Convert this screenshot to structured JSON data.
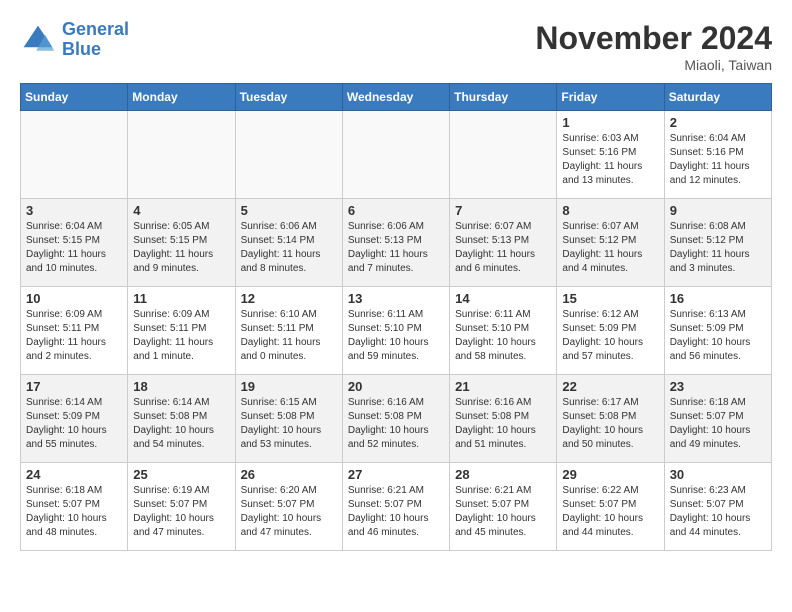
{
  "logo": {
    "line1": "General",
    "line2": "Blue"
  },
  "title": "November 2024",
  "location": "Miaoli, Taiwan",
  "days_header": [
    "Sunday",
    "Monday",
    "Tuesday",
    "Wednesday",
    "Thursday",
    "Friday",
    "Saturday"
  ],
  "weeks": [
    [
      {
        "day": "",
        "info": ""
      },
      {
        "day": "",
        "info": ""
      },
      {
        "day": "",
        "info": ""
      },
      {
        "day": "",
        "info": ""
      },
      {
        "day": "",
        "info": ""
      },
      {
        "day": "1",
        "info": "Sunrise: 6:03 AM\nSunset: 5:16 PM\nDaylight: 11 hours\nand 13 minutes."
      },
      {
        "day": "2",
        "info": "Sunrise: 6:04 AM\nSunset: 5:16 PM\nDaylight: 11 hours\nand 12 minutes."
      }
    ],
    [
      {
        "day": "3",
        "info": "Sunrise: 6:04 AM\nSunset: 5:15 PM\nDaylight: 11 hours\nand 10 minutes."
      },
      {
        "day": "4",
        "info": "Sunrise: 6:05 AM\nSunset: 5:15 PM\nDaylight: 11 hours\nand 9 minutes."
      },
      {
        "day": "5",
        "info": "Sunrise: 6:06 AM\nSunset: 5:14 PM\nDaylight: 11 hours\nand 8 minutes."
      },
      {
        "day": "6",
        "info": "Sunrise: 6:06 AM\nSunset: 5:13 PM\nDaylight: 11 hours\nand 7 minutes."
      },
      {
        "day": "7",
        "info": "Sunrise: 6:07 AM\nSunset: 5:13 PM\nDaylight: 11 hours\nand 6 minutes."
      },
      {
        "day": "8",
        "info": "Sunrise: 6:07 AM\nSunset: 5:12 PM\nDaylight: 11 hours\nand 4 minutes."
      },
      {
        "day": "9",
        "info": "Sunrise: 6:08 AM\nSunset: 5:12 PM\nDaylight: 11 hours\nand 3 minutes."
      }
    ],
    [
      {
        "day": "10",
        "info": "Sunrise: 6:09 AM\nSunset: 5:11 PM\nDaylight: 11 hours\nand 2 minutes."
      },
      {
        "day": "11",
        "info": "Sunrise: 6:09 AM\nSunset: 5:11 PM\nDaylight: 11 hours\nand 1 minute."
      },
      {
        "day": "12",
        "info": "Sunrise: 6:10 AM\nSunset: 5:11 PM\nDaylight: 11 hours\nand 0 minutes."
      },
      {
        "day": "13",
        "info": "Sunrise: 6:11 AM\nSunset: 5:10 PM\nDaylight: 10 hours\nand 59 minutes."
      },
      {
        "day": "14",
        "info": "Sunrise: 6:11 AM\nSunset: 5:10 PM\nDaylight: 10 hours\nand 58 minutes."
      },
      {
        "day": "15",
        "info": "Sunrise: 6:12 AM\nSunset: 5:09 PM\nDaylight: 10 hours\nand 57 minutes."
      },
      {
        "day": "16",
        "info": "Sunrise: 6:13 AM\nSunset: 5:09 PM\nDaylight: 10 hours\nand 56 minutes."
      }
    ],
    [
      {
        "day": "17",
        "info": "Sunrise: 6:14 AM\nSunset: 5:09 PM\nDaylight: 10 hours\nand 55 minutes."
      },
      {
        "day": "18",
        "info": "Sunrise: 6:14 AM\nSunset: 5:08 PM\nDaylight: 10 hours\nand 54 minutes."
      },
      {
        "day": "19",
        "info": "Sunrise: 6:15 AM\nSunset: 5:08 PM\nDaylight: 10 hours\nand 53 minutes."
      },
      {
        "day": "20",
        "info": "Sunrise: 6:16 AM\nSunset: 5:08 PM\nDaylight: 10 hours\nand 52 minutes."
      },
      {
        "day": "21",
        "info": "Sunrise: 6:16 AM\nSunset: 5:08 PM\nDaylight: 10 hours\nand 51 minutes."
      },
      {
        "day": "22",
        "info": "Sunrise: 6:17 AM\nSunset: 5:08 PM\nDaylight: 10 hours\nand 50 minutes."
      },
      {
        "day": "23",
        "info": "Sunrise: 6:18 AM\nSunset: 5:07 PM\nDaylight: 10 hours\nand 49 minutes."
      }
    ],
    [
      {
        "day": "24",
        "info": "Sunrise: 6:18 AM\nSunset: 5:07 PM\nDaylight: 10 hours\nand 48 minutes."
      },
      {
        "day": "25",
        "info": "Sunrise: 6:19 AM\nSunset: 5:07 PM\nDaylight: 10 hours\nand 47 minutes."
      },
      {
        "day": "26",
        "info": "Sunrise: 6:20 AM\nSunset: 5:07 PM\nDaylight: 10 hours\nand 47 minutes."
      },
      {
        "day": "27",
        "info": "Sunrise: 6:21 AM\nSunset: 5:07 PM\nDaylight: 10 hours\nand 46 minutes."
      },
      {
        "day": "28",
        "info": "Sunrise: 6:21 AM\nSunset: 5:07 PM\nDaylight: 10 hours\nand 45 minutes."
      },
      {
        "day": "29",
        "info": "Sunrise: 6:22 AM\nSunset: 5:07 PM\nDaylight: 10 hours\nand 44 minutes."
      },
      {
        "day": "30",
        "info": "Sunrise: 6:23 AM\nSunset: 5:07 PM\nDaylight: 10 hours\nand 44 minutes."
      }
    ]
  ]
}
